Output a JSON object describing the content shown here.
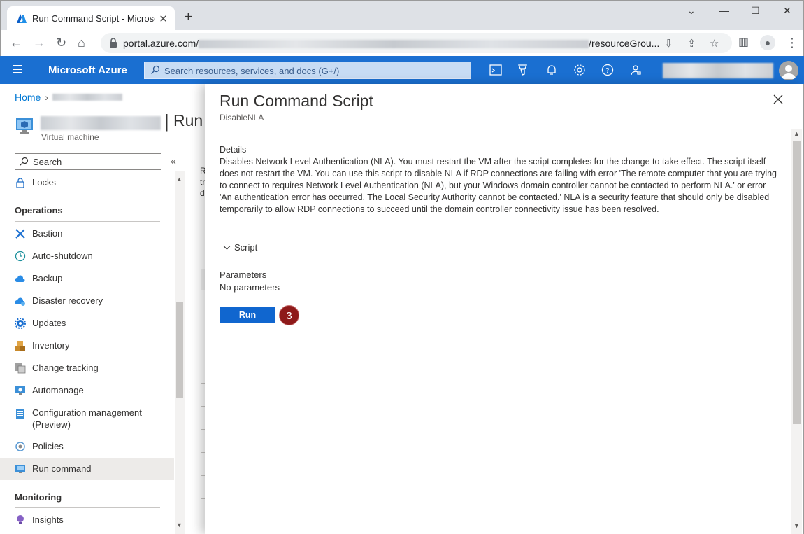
{
  "browser": {
    "tab_title": "Run Command Script - Microsoft",
    "url_prefix": "portal.azure.com/",
    "url_suffix": "/resourceGrou..."
  },
  "azure": {
    "brand": "Microsoft Azure",
    "search_placeholder": "Search resources, services, and docs (G+/)"
  },
  "blade": {
    "breadcrumb_home": "Home",
    "vm_subtitle": "Virtual machine",
    "title_fragment": "Run",
    "search_placeholder": "Search",
    "collapse_glyph": "«",
    "background_text": [
      "R",
      "tr",
      "d"
    ]
  },
  "nav": {
    "top_item": "Locks",
    "operations_header": "Operations",
    "items": [
      "Bastion",
      "Auto-shutdown",
      "Backup",
      "Disaster recovery",
      "Updates",
      "Inventory",
      "Change tracking",
      "Automanage",
      "Configuration management",
      "Policies",
      "Run command"
    ],
    "config_mgmt_line2": "(Preview)",
    "monitoring_header": "Monitoring",
    "insights": "Insights"
  },
  "panel": {
    "title": "Run Command Script",
    "subtitle": "DisableNLA",
    "details_label": "Details",
    "details_text": "Disables Network Level Authentication (NLA). You must restart the VM after the script completes for the change to take effect. The script itself does not restart the VM. You can use this script to disable NLA if RDP connections are failing with error 'The remote computer that you are trying to connect to requires Network Level Authentication (NLA), but your Windows domain controller cannot be contacted to perform NLA.' or error 'An authentication error has occurred. The Local Security Authority cannot be contacted.' NLA is a security feature that should only be disabled temporarily to allow RDP connections to succeed until the domain controller connectivity issue has been resolved.",
    "script_label": "Script",
    "parameters_label": "Parameters",
    "parameters_value": "No parameters",
    "run_label": "Run",
    "step_badge": "3"
  },
  "colors": {
    "azure_header": "#1a6fd1",
    "run_button": "#1066cf",
    "step_badge": "#8e1a1a"
  }
}
